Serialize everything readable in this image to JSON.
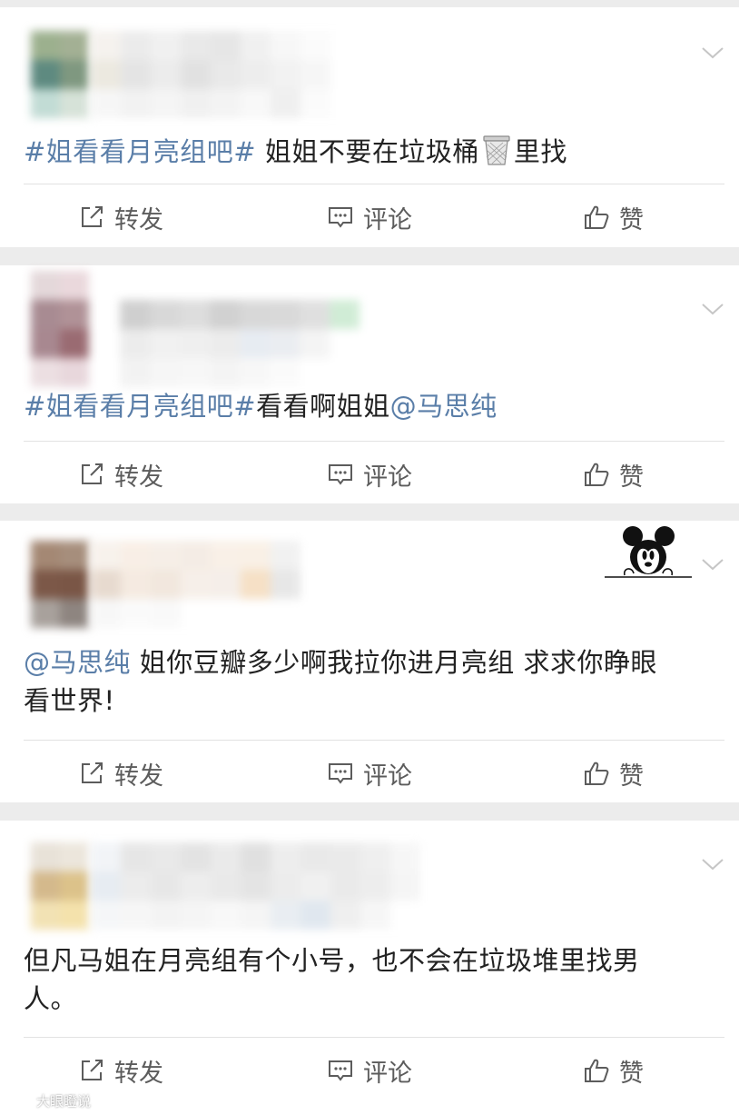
{
  "actions": {
    "repost": "转发",
    "comment": "评论",
    "like": "赞"
  },
  "posts": [
    {
      "topic": "#姐看看月亮组吧#",
      "text_before_icon": " 姐姐不要在垃圾桶",
      "icon": "trash-can-emoji",
      "text_after_icon": "里找"
    },
    {
      "topic": "#姐看看月亮组吧#",
      "text": "看看啊姐姐",
      "mention": "@马思纯"
    },
    {
      "mention": "@马思纯",
      "text_line1": " 姐你豆瓣多少啊我拉你进月亮组 求求你睁眼",
      "text_line2": "看世界!",
      "decoration": "mickey-mouse-peeking"
    },
    {
      "text_line1": "但凡马姐在月亮组有个小号，也不会在垃圾堆里找男",
      "text_line2": "人。"
    }
  ],
  "watermark": {
    "text": "大眼瞪说"
  },
  "colors": {
    "link": "#5a7ea8",
    "text": "#222222",
    "action": "#5c5c5c",
    "background": "#ececec"
  }
}
